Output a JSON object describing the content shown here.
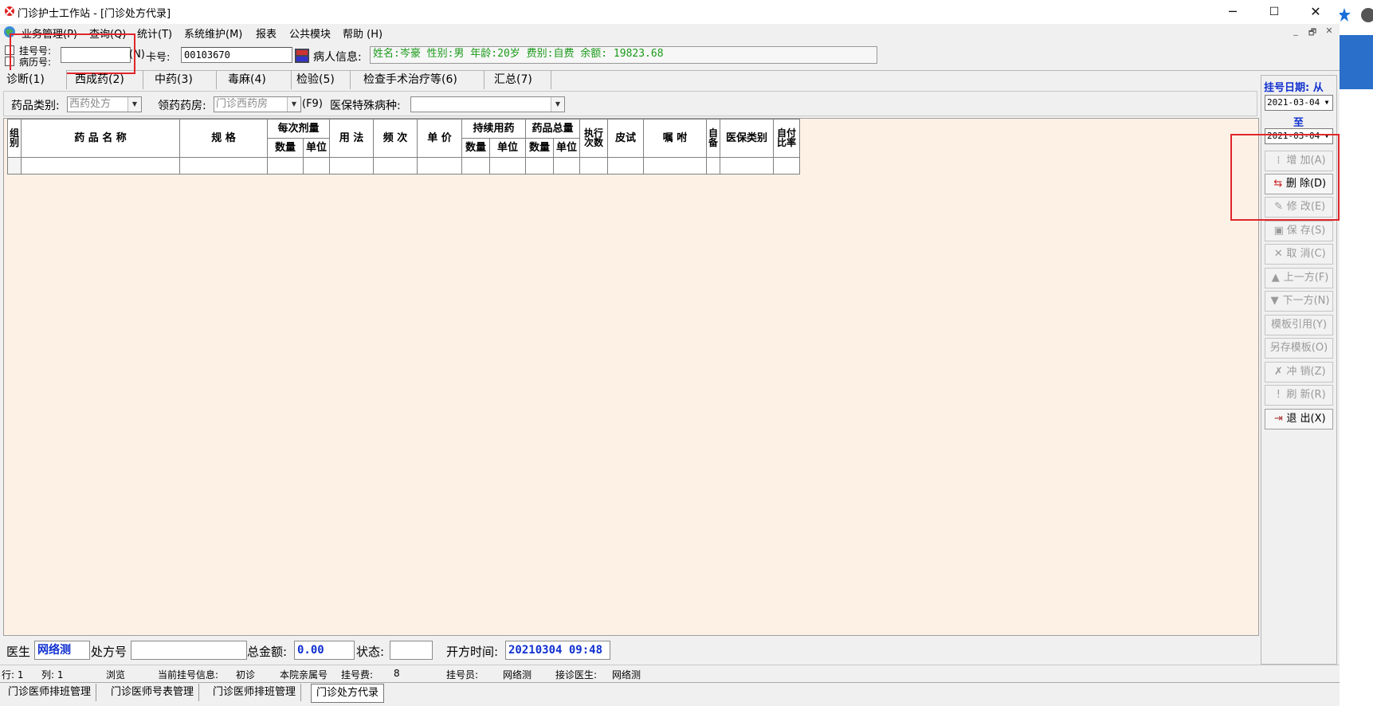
{
  "window": {
    "title": "门诊护士工作站 - [门诊处方代录]",
    "btn_min": "─",
    "btn_max": "☐",
    "btn_close": "✕"
  },
  "menu": [
    "业务管理(P)",
    "查询(Q)",
    "统计(T)",
    "系统维护(M)",
    "报表",
    "公共模块",
    "帮助 (H)"
  ],
  "mdi_controls": [
    "_",
    "🗗",
    "✕"
  ],
  "toolbar": {
    "reg_label": "挂号号:",
    "record_label": "病历号:",
    "reg_value": "",
    "n_hotkey": "(N)",
    "card_label": "卡号:",
    "card_value": "00103670",
    "patient_label": "病人信息:",
    "patient_info": "姓名:岑豪 性别:男 年龄:20岁 费别:自费 余额: 19823.68"
  },
  "tabs": [
    "诊断(1)",
    "西成药(2)",
    "中药(3)",
    "毒麻(4)",
    "检验(5)",
    "检查手术治疗等(6)",
    "汇总(7)"
  ],
  "filters": {
    "drug_type_label": "药品类别:",
    "drug_type_value": "西药处方",
    "pharmacy_label": "领药药房:",
    "pharmacy_value": "门诊西药房",
    "f9": "(F9)",
    "insurance_label": "医保特殊病种:",
    "insurance_value": ""
  },
  "grid": {
    "col_group": "组别",
    "col_name": "药 品 名 称",
    "col_spec": "规 格",
    "col_dose": "每次剂量",
    "col_qty": "数量",
    "col_unit": "单位",
    "col_usage": "用 法",
    "col_freq": "频 次",
    "col_price": "单 价",
    "col_cont": "持续用药",
    "col_total": "药品总量",
    "col_exec": "执行次数",
    "col_skin": "皮试",
    "col_note": "嘱 咐",
    "col_self": "自备",
    "col_ins": "医保类别",
    "col_ratio": "自付比率"
  },
  "sidebar": {
    "reg_date_label": "挂号日期: 从",
    "date_from": "2021-03-04",
    "to_label": "至",
    "date_to": "2021-03-04",
    "buttons": [
      {
        "icon": "⁞",
        "label": "增 加(A)",
        "enabled": false
      },
      {
        "icon": "⇆",
        "label": "删 除(D)",
        "enabled": true
      },
      {
        "icon": "✎",
        "label": "修 改(E)",
        "enabled": false
      },
      {
        "icon": "▣",
        "label": "保 存(S)",
        "enabled": false
      },
      {
        "icon": "✕",
        "label": "取 消(C)",
        "enabled": false
      },
      {
        "icon": "▲",
        "label": "上一方(F)",
        "enabled": false
      },
      {
        "icon": "▼",
        "label": "下一方(N)",
        "enabled": false
      },
      {
        "icon": "",
        "label": "模板引用(Y)",
        "enabled": false
      },
      {
        "icon": "",
        "label": "另存模板(O)",
        "enabled": false
      },
      {
        "icon": "✗",
        "label": "冲 销(Z)",
        "enabled": false
      },
      {
        "icon": "!",
        "label": "刷 新(R)",
        "enabled": false
      },
      {
        "icon": "⇥",
        "label": "退 出(X)",
        "enabled": true
      }
    ]
  },
  "bottom": {
    "doctor_label": "医生",
    "doctor_value": "网络测",
    "rx_label": "处方号",
    "rx_value": "",
    "total_label": "总金额:",
    "total_value": "0.00",
    "status_label": "状态:",
    "status_value": "",
    "time_label": "开方时间:",
    "time_value": "20210304 09:48"
  },
  "statusbar": {
    "row": "行: 1",
    "col": "列: 1",
    "mode": "浏览",
    "reg_info": "当前挂号信息:",
    "visit": "初诊",
    "dept": "本院亲属号",
    "fee_label": "挂号费:",
    "fee": "8",
    "staff_label": "挂号员:",
    "staff": "网络测",
    "doctor_label": "接诊医生:",
    "doctor": "网络测"
  },
  "taskbar": [
    "门诊医师排班管理",
    "门诊医师号表管理",
    "门诊医师排班管理",
    "门诊处方代录"
  ]
}
